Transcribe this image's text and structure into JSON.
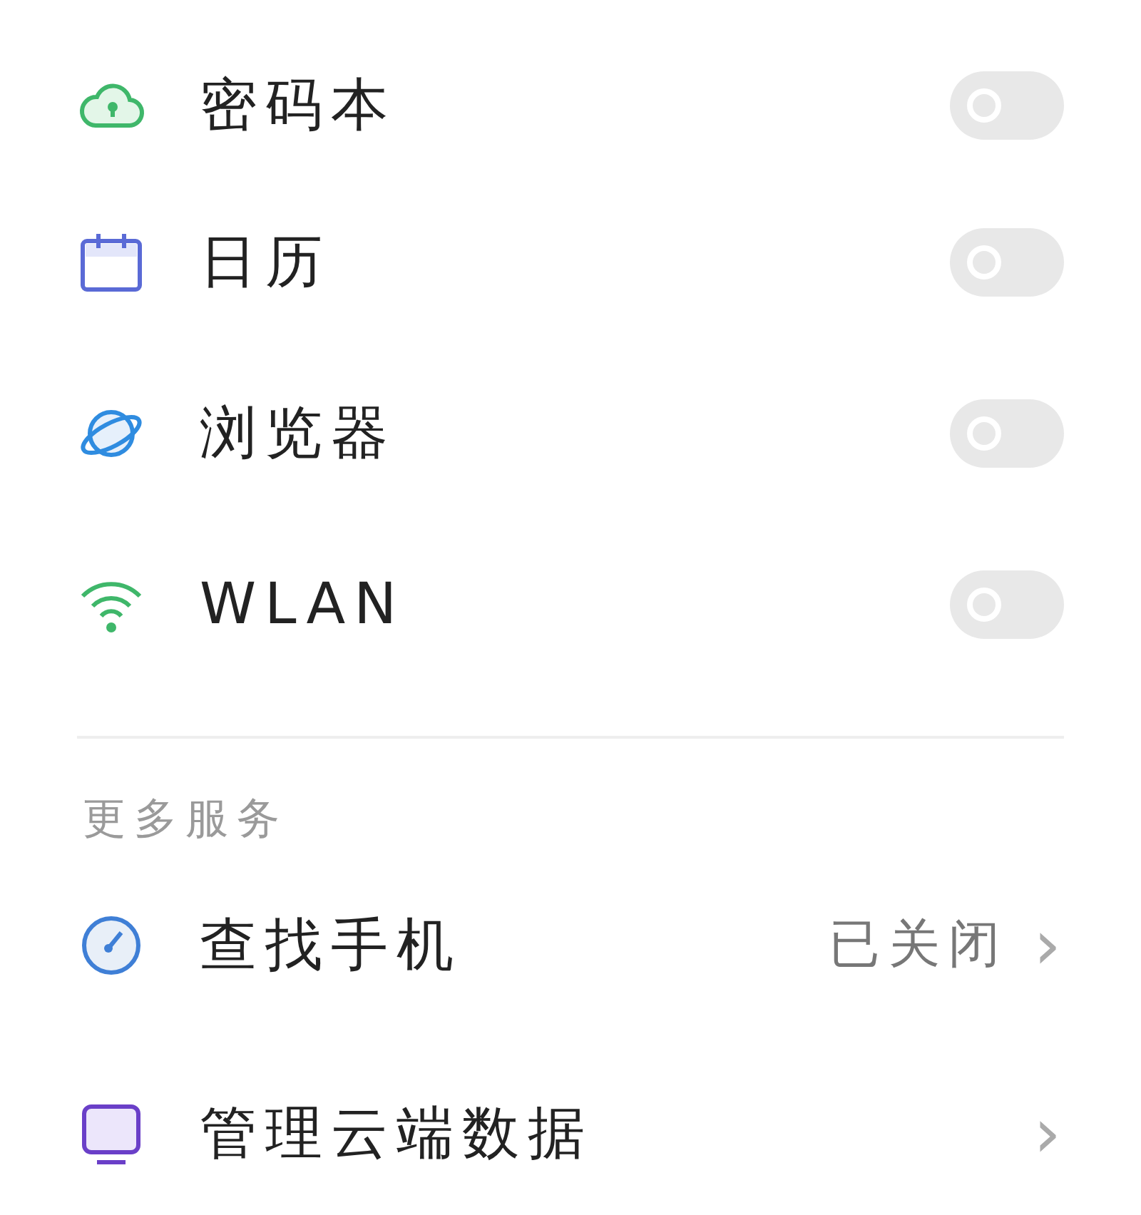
{
  "toggle_items": [
    {
      "label": "密码本",
      "on": false
    },
    {
      "label": "日历",
      "on": false
    },
    {
      "label": "浏览器",
      "on": false
    },
    {
      "label": "WLAN",
      "on": false
    }
  ],
  "section_title": "更多服务",
  "link_items": [
    {
      "label": "查找手机",
      "value": "已关闭",
      "chevron": "›"
    },
    {
      "label": "管理云端数据",
      "chevron": "›"
    }
  ]
}
